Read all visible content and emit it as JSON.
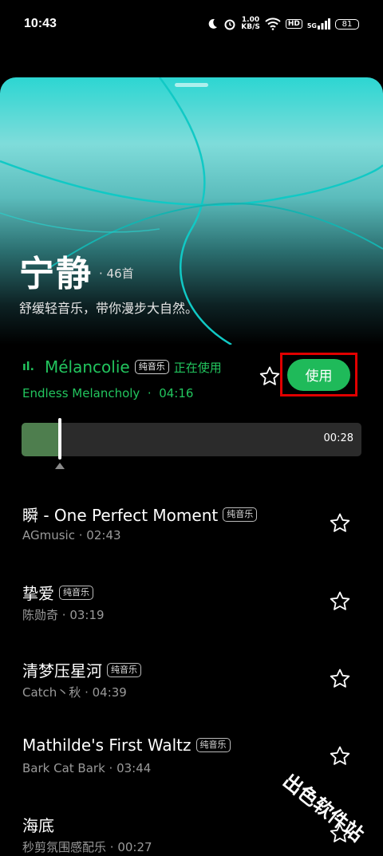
{
  "status_bar": {
    "time": "10:43",
    "speed_value": "1.00",
    "speed_unit": "KB/S",
    "hd": "HD",
    "signal": "5G",
    "battery": "81"
  },
  "playlist": {
    "title": "宁静",
    "count": "· 46首",
    "description": "舒缓轻音乐，带你漫步大自然。"
  },
  "now_playing": {
    "title": "Mélancolie",
    "tag": "纯音乐",
    "status": "正在使用",
    "artist": "Endless Melancholy",
    "duration": "04:16",
    "use_button": "使用",
    "progress_time": "00:28",
    "progress_fraction": 0.109
  },
  "songs": [
    {
      "title": "瞬 - One Perfect Moment",
      "tag": "纯音乐",
      "artist": "AGmusic",
      "duration": "02:43"
    },
    {
      "title": "挚爱",
      "tag": "纯音乐",
      "artist": "陈勋奇",
      "duration": "03:19"
    },
    {
      "title": "清梦压星河",
      "tag": "纯音乐",
      "artist": "Catch丶秋",
      "duration": "04:39"
    },
    {
      "title": "Mathilde's First Waltz",
      "tag": "纯音乐",
      "artist": "Bark Cat Bark",
      "duration": "03:44"
    },
    {
      "title": "海底",
      "tag": "",
      "artist": "秒剪氛围感配乐",
      "duration": "00:27"
    }
  ],
  "watermark": "出色软件站",
  "colors": {
    "accent": "#22c55e",
    "button": "#1fba5a",
    "highlight_border": "#e00000"
  }
}
